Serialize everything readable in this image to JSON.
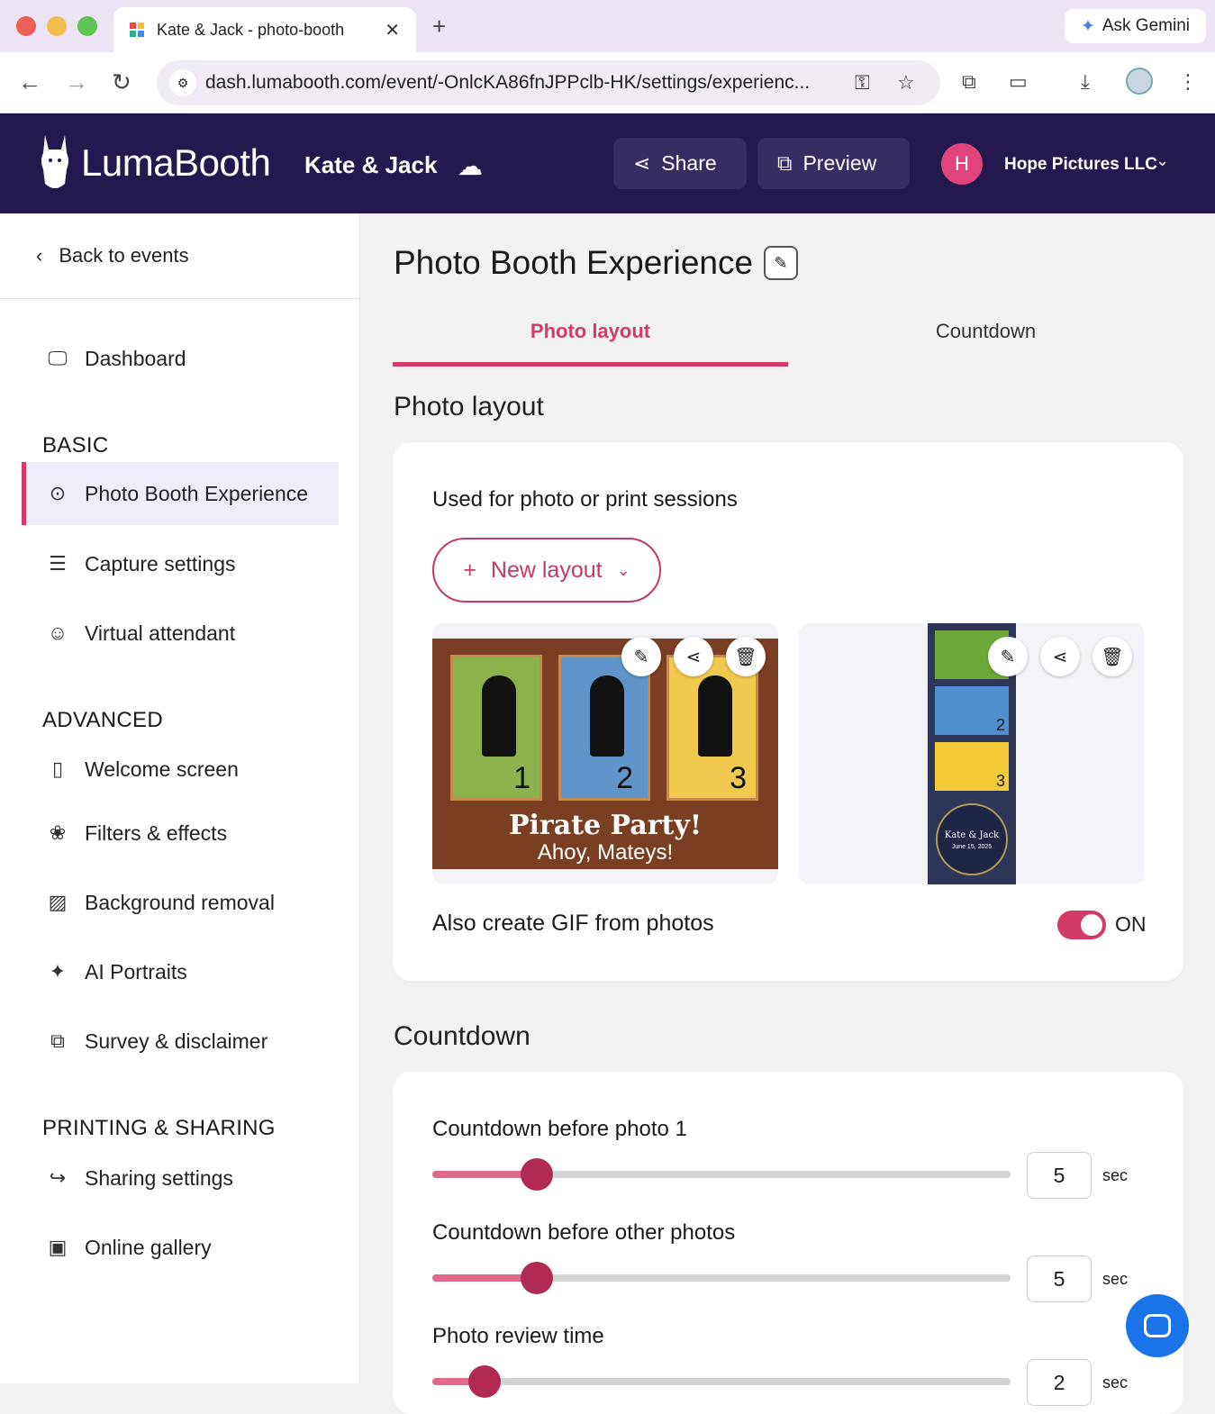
{
  "browser": {
    "tab_title": "Kate & Jack - photo-booth",
    "url": "dash.lumabooth.com/event/-OnlcKA86fnJPPclb-HK/settings/experienc...",
    "gemini_label": "Ask Gemini"
  },
  "header": {
    "logo_text": "LumaBooth",
    "event_name": "Kate & Jack",
    "share_label": "Share",
    "preview_label": "Preview",
    "org_initial": "H",
    "org_name": "Hope Pictures LLC"
  },
  "sidebar": {
    "back_label": "Back to events",
    "dashboard": "Dashboard",
    "section_basic": "BASIC",
    "basic_items": [
      "Photo Booth Experience",
      "Capture settings",
      "Virtual attendant"
    ],
    "section_advanced": "ADVANCED",
    "advanced_items": [
      "Welcome screen",
      "Filters & effects",
      "Background removal",
      "AI Portraits",
      "Survey & disclaimer"
    ],
    "section_sharing": "PRINTING & SHARING",
    "sharing_items": [
      "Sharing settings",
      "Online gallery"
    ]
  },
  "main": {
    "page_title": "Photo Booth Experience",
    "tabs": [
      "Photo layout",
      "Countdown"
    ],
    "photo_layout": {
      "heading": "Photo layout",
      "subtitle": "Used for photo or print sessions",
      "new_layout_label": "New layout",
      "layout1": {
        "slots": [
          "1",
          "2",
          "3"
        ],
        "title": "Pirate Party!",
        "subtitle": "Ahoy, Mateys!"
      },
      "layout2": {
        "slots": [
          "2",
          "3"
        ],
        "names": "Kate & Jack",
        "date": "June 15, 2025"
      },
      "gif_label": "Also create GIF from photos",
      "gif_state": "ON"
    },
    "countdown": {
      "heading": "Countdown",
      "sliders": [
        {
          "label": "Countdown before photo 1",
          "value": "5",
          "unit": "sec",
          "fraction": 0.18
        },
        {
          "label": "Countdown before other photos",
          "value": "5",
          "unit": "sec",
          "fraction": 0.18
        },
        {
          "label": "Photo review time",
          "value": "2",
          "unit": "sec",
          "fraction": 0.09
        }
      ]
    }
  },
  "colors": {
    "accent": "#d23a67",
    "appbar": "#24194f",
    "chat": "#1a73e8"
  }
}
